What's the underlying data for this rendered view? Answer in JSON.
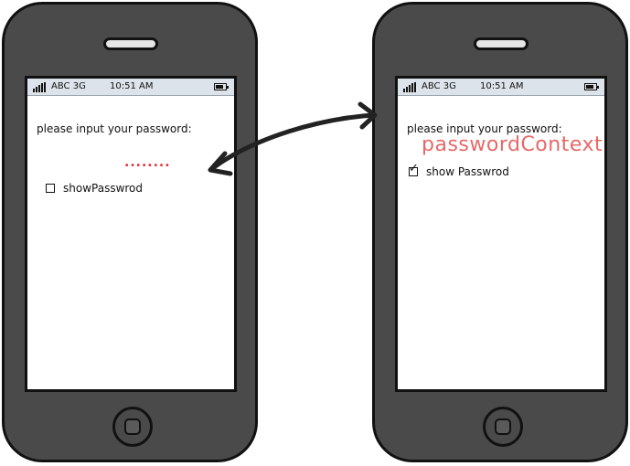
{
  "status_bar": {
    "carrier": "ABC",
    "network": "3G",
    "time": "10:51 AM"
  },
  "left_screen": {
    "prompt": "please input your password:",
    "password_masked": "........",
    "checkbox_label": "showPasswrod",
    "checked": false
  },
  "right_screen": {
    "prompt": "please input your password:",
    "password_plain": "passwordContext",
    "checkbox_label": "show Passwrod",
    "checked": true
  },
  "colors": {
    "phone_body": "#4a4a4a",
    "masked_text": "#e03030",
    "plain_text": "#e86868"
  }
}
